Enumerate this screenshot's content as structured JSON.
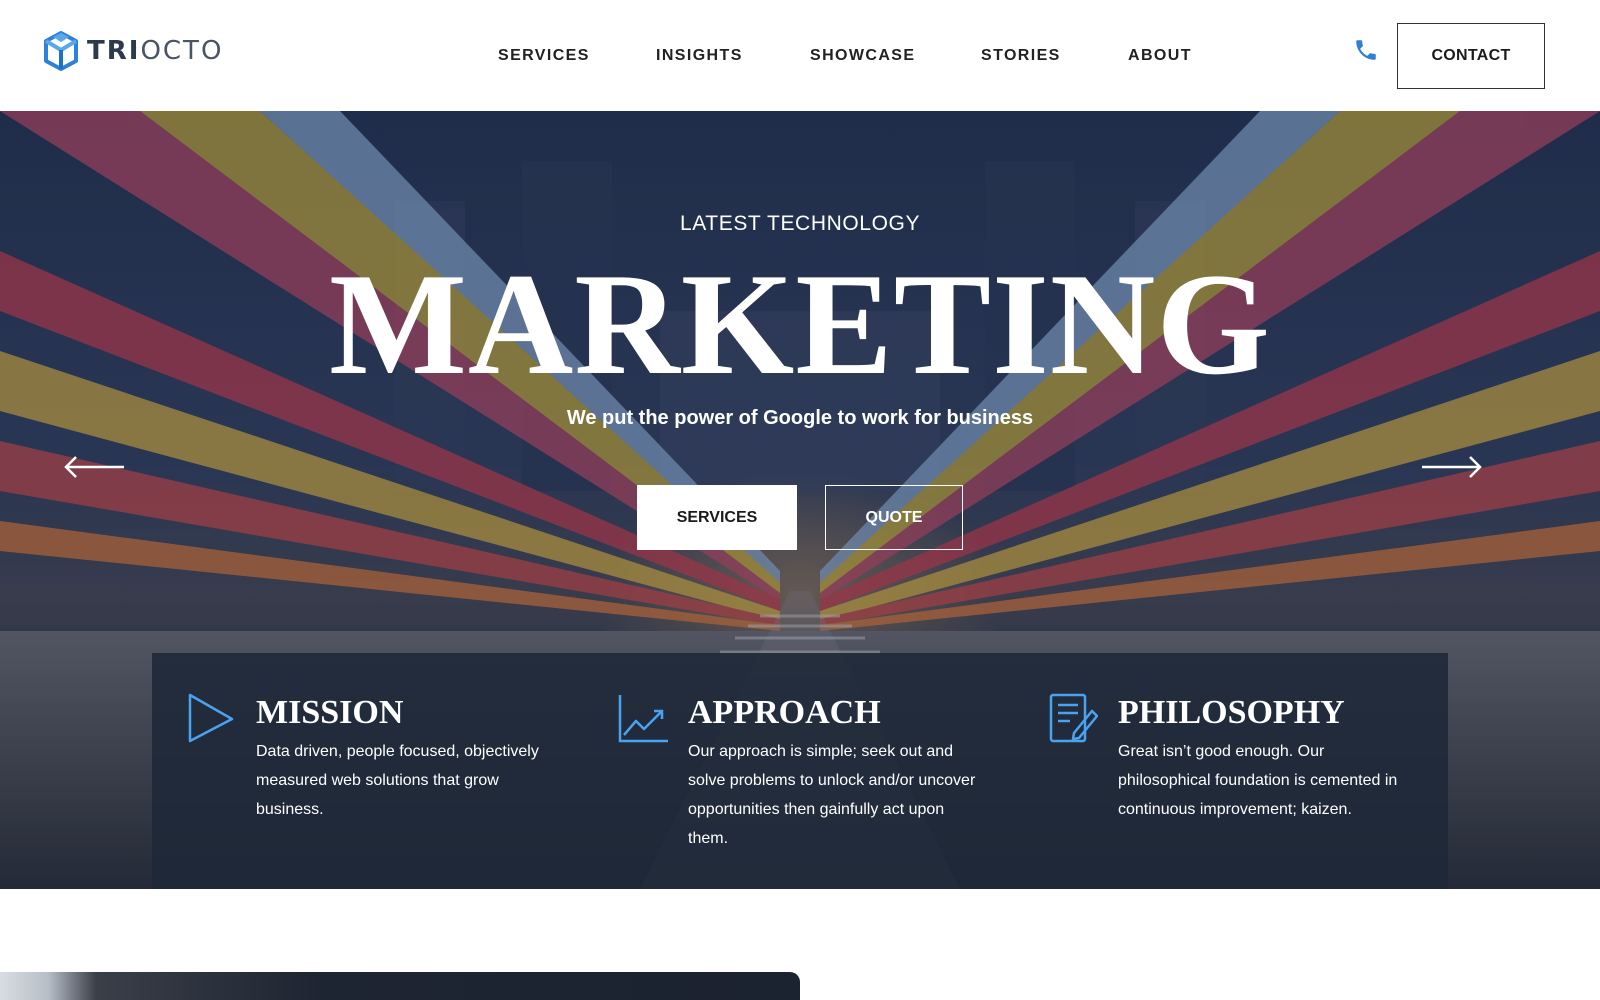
{
  "header": {
    "logo": {
      "text_bold": "TRI",
      "text_light": "OCTO",
      "icon": "cube-logo-icon",
      "brand_color": "#2f80d8"
    },
    "nav": [
      {
        "label": "SERVICES"
      },
      {
        "label": "INSIGHTS"
      },
      {
        "label": "SHOWCASE"
      },
      {
        "label": "STORIES"
      },
      {
        "label": "ABOUT"
      }
    ],
    "phone_icon": "phone-icon",
    "contact_label": "CONTACT"
  },
  "hero": {
    "kicker": "LATEST TECHNOLOGY",
    "title": "MARKETING",
    "subtitle": "We put the power of Google to work for business",
    "prev_icon": "arrow-left-icon",
    "next_icon": "arrow-right-icon",
    "primary_button": "SERVICES",
    "secondary_button": "QUOTE"
  },
  "features": [
    {
      "icon": "play-triangle-icon",
      "title": "MISSION",
      "text": "Data driven, people focused, objectively measured web solutions that grow business."
    },
    {
      "icon": "line-chart-icon",
      "title": "APPROACH",
      "text": "Our approach is simple; seek out and solve problems to unlock and/or uncover opportunities then gainfully act upon them."
    },
    {
      "icon": "edit-document-icon",
      "title": "PHILOSOPHY",
      "text": "Great isn’t good enough. Our philosophical foundation is cemented in continuous improvement; kaizen."
    }
  ],
  "colors": {
    "accent": "#3a8fe0",
    "icon_outline": "#4aa3f0",
    "panel": "#1e2838",
    "text_dark": "#1b1b1b"
  }
}
